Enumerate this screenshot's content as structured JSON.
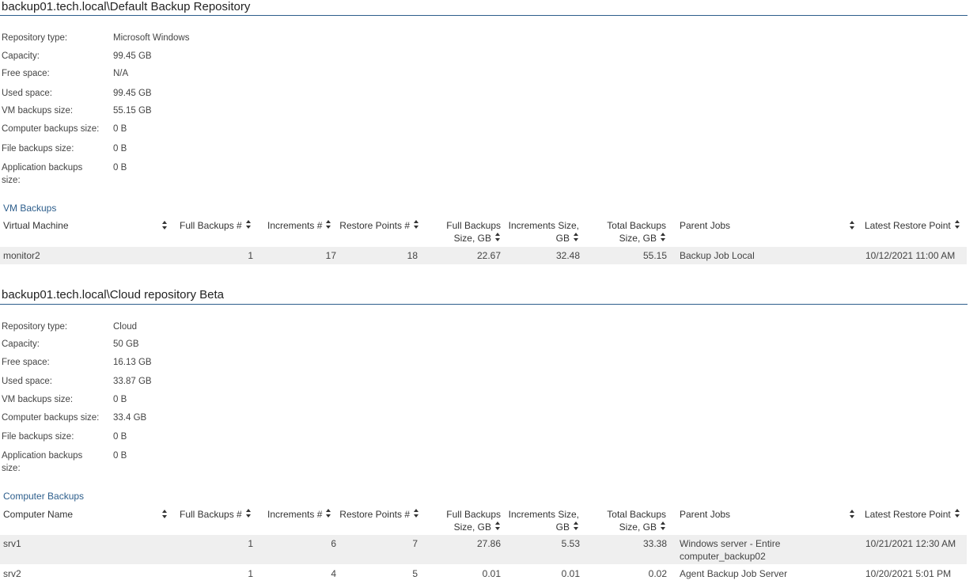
{
  "repos": [
    {
      "title": "backup01.tech.local\\Default Backup Repository",
      "props": [
        {
          "label": "Repository type:",
          "value": "Microsoft Windows"
        },
        {
          "label": "Capacity:",
          "value": "99.45 GB"
        },
        {
          "label": "Free space:",
          "value": "N/A"
        },
        {
          "label": "Used space:",
          "value": "99.45 GB"
        },
        {
          "label": "VM backups size:",
          "value": "55.15 GB"
        },
        {
          "label": "Computer backups size:",
          "value": "0 B"
        },
        {
          "label": "File backups size:",
          "value": "0 B"
        },
        {
          "label": "Application backups size:",
          "value": "0 B"
        }
      ],
      "section": {
        "title": "VM Backups",
        "headers": [
          "Virtual Machine",
          "Full Backups #",
          "Increments #",
          "Restore Points #",
          "Full Backups Size, GB",
          "Increments Size, GB",
          "Total Backups Size, GB",
          "Parent Jobs",
          "Latest Restore Point"
        ],
        "rows": [
          {
            "name": "monitor2",
            "full": "1",
            "inc": "17",
            "rp": "18",
            "full_size": "22.67",
            "inc_size": "32.48",
            "total": "55.15",
            "parent": "Backup Job Local",
            "latest": "10/12/2021 11:00 AM"
          }
        ]
      }
    },
    {
      "title": "backup01.tech.local\\Cloud repository Beta",
      "props": [
        {
          "label": "Repository type:",
          "value": "Cloud"
        },
        {
          "label": "Capacity:",
          "value": "50 GB"
        },
        {
          "label": "Free space:",
          "value": "16.13 GB"
        },
        {
          "label": "Used space:",
          "value": "33.87 GB"
        },
        {
          "label": "VM backups size:",
          "value": "0 B"
        },
        {
          "label": "Computer backups size:",
          "value": "33.4 GB"
        },
        {
          "label": "File backups size:",
          "value": "0 B"
        },
        {
          "label": "Application backups size:",
          "value": "0 B"
        }
      ],
      "section": {
        "title": "Computer Backups",
        "headers": [
          "Computer Name",
          "Full Backups #",
          "Increments #",
          "Restore Points #",
          "Full Backups Size, GB",
          "Increments Size, GB",
          "Total Backups Size, GB",
          "Parent Jobs",
          "Latest Restore Point"
        ],
        "rows": [
          {
            "name": "srv1",
            "full": "1",
            "inc": "6",
            "rp": "7",
            "full_size": "27.86",
            "inc_size": "5.53",
            "total": "33.38",
            "parent": "Windows server - Entire computer_backup02",
            "latest": "10/21/2021 12:30 AM"
          },
          {
            "name": "srv2",
            "full": "1",
            "inc": "4",
            "rp": "5",
            "full_size": "0.01",
            "inc_size": "0.01",
            "total": "0.02",
            "parent": "Agent Backup Job Server",
            "latest": "10/20/2021 5:01 PM"
          }
        ]
      }
    }
  ]
}
